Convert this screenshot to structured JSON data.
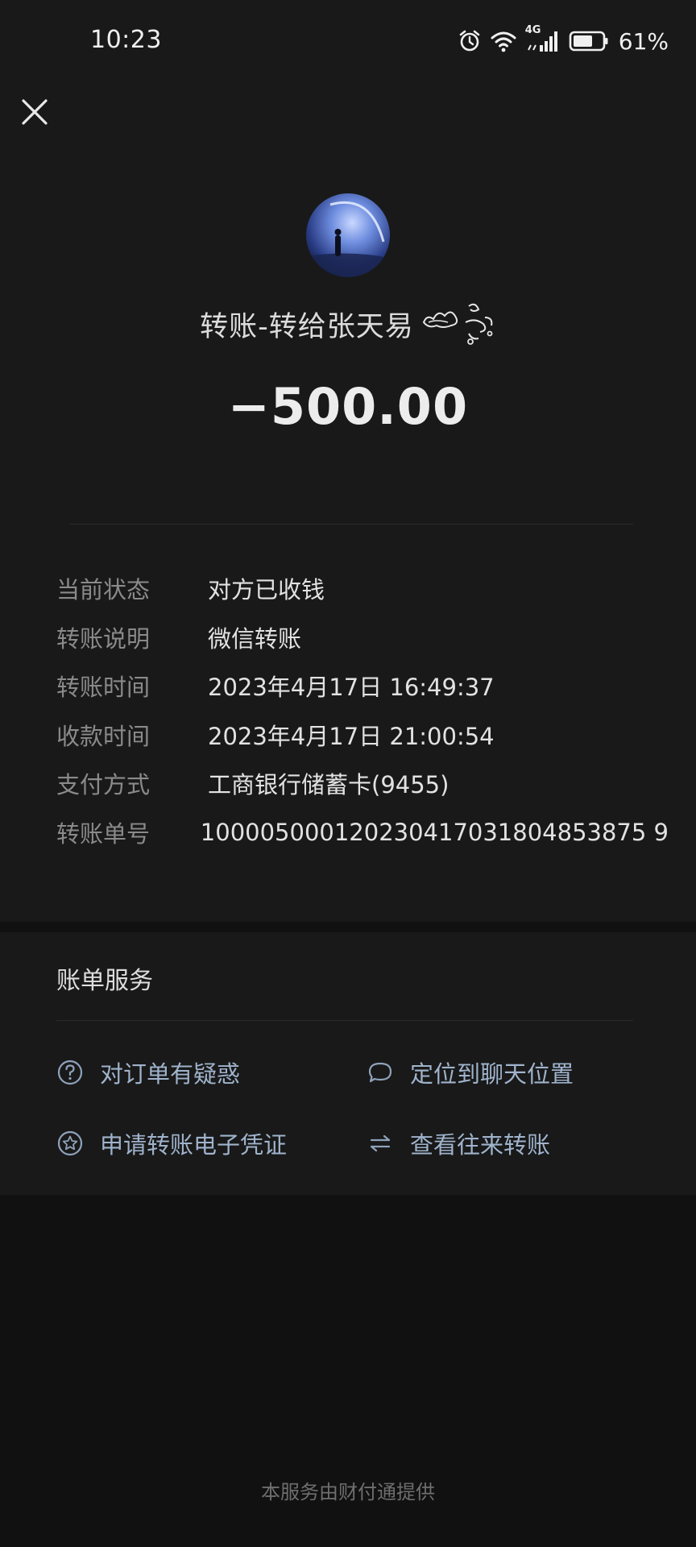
{
  "status_bar": {
    "time": "10:23",
    "network": "4G",
    "battery_percent": "61%",
    "icons": [
      "alarm-icon",
      "wifi-icon",
      "signal-icon",
      "battery-icon"
    ]
  },
  "header": {
    "close_icon": "close-icon"
  },
  "transfer": {
    "avatar_icon": "avatar",
    "title": "转账-转给张天易",
    "amount": "−500.00"
  },
  "details": [
    {
      "label": "当前状态",
      "value": "对方已收钱"
    },
    {
      "label": "转账说明",
      "value": "微信转账"
    },
    {
      "label": "转账时间",
      "value": "2023年4月17日 16:49:37"
    },
    {
      "label": "收款时间",
      "value": "2023年4月17日 21:00:54"
    },
    {
      "label": "支付方式",
      "value": "工商银行储蓄卡(9455)"
    },
    {
      "label": "转账单号",
      "value": "100005000120230417031804853875 9"
    }
  ],
  "services": {
    "title": "账单服务",
    "items": [
      {
        "label": "对订单有疑惑",
        "icon": "question-icon"
      },
      {
        "label": "定位到聊天位置",
        "icon": "chat-bubble-icon"
      },
      {
        "label": "申请转账电子凭证",
        "icon": "star-icon"
      },
      {
        "label": "查看往来转账",
        "icon": "exchange-icon"
      }
    ]
  },
  "footer": "本服务由财付通提供",
  "colors": {
    "background": "#111111",
    "panel": "#191919",
    "link": "#9fb3cc",
    "label": "#8a8a8a"
  }
}
